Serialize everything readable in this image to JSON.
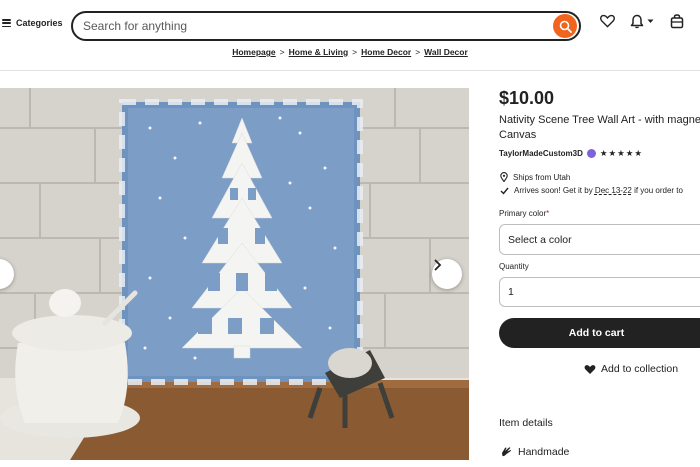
{
  "header": {
    "categories_label": "Categories",
    "search_placeholder": "Search for anything"
  },
  "breadcrumb": [
    "Homepage",
    "Home & Living",
    "Home Decor",
    "Wall Decor"
  ],
  "listing": {
    "price": "$10.00",
    "title_line1": "Nativity Scene Tree Wall Art - with magne",
    "title_line2": "Canvas",
    "shop_name": "TaylorMadeCustom3D",
    "rating_stars": 5,
    "ships_from": "Ships from Utah",
    "arrives_prefix": "Arrives soon! Get it by ",
    "arrives_date": "Dec 13-22",
    "arrives_suffix": " if you order to"
  },
  "form": {
    "primary_color_label": "Primary color",
    "required_mark": "*",
    "select_value": "Select a color",
    "quantity_label": "Quantity",
    "quantity_value": "1"
  },
  "actions": {
    "add_to_cart": "Add to cart",
    "add_to_collection": "Add to collection"
  },
  "details": {
    "heading": "Item details",
    "handmade": "Handmade"
  },
  "colors": {
    "accent": "#f1641e",
    "button_dark": "#222222",
    "star_seller": "#7f62d9"
  }
}
